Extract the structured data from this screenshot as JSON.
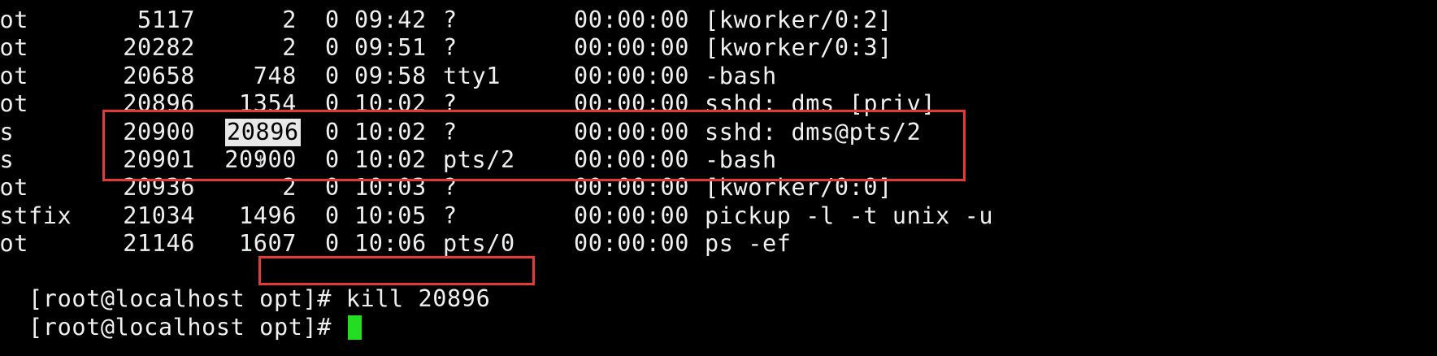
{
  "theme": {
    "background": "#000000",
    "foreground": "#f0f0f0",
    "selection_bg": "#e8e8e8",
    "cursor_color": "#22dd22",
    "annotation_color": "#e53935"
  },
  "process_rows": [
    {
      "uid": "root",
      "pid": "5117",
      "ppid": "2",
      "c": "0",
      "stime": "09:42",
      "tty": "?",
      "time": "00:00:00",
      "cmd": "[kworker/0:2]"
    },
    {
      "uid": "root",
      "pid": "20282",
      "ppid": "2",
      "c": "0",
      "stime": "09:51",
      "tty": "?",
      "time": "00:00:00",
      "cmd": "[kworker/0:3]"
    },
    {
      "uid": "root",
      "pid": "20658",
      "ppid": "748",
      "c": "0",
      "stime": "09:58",
      "tty": "tty1",
      "time": "00:00:00",
      "cmd": "-bash"
    },
    {
      "uid": "root",
      "pid": "20896",
      "ppid": "1354",
      "c": "0",
      "stime": "10:02",
      "tty": "?",
      "time": "00:00:00",
      "cmd": "sshd: dms [priv]"
    },
    {
      "uid": "dms",
      "pid": "20900",
      "ppid": "20896",
      "c": "0",
      "stime": "10:02",
      "tty": "?",
      "time": "00:00:00",
      "cmd": "sshd: dms@pts/2"
    },
    {
      "uid": "dms",
      "pid": "20901",
      "ppid": "20900",
      "c": "0",
      "stime": "10:02",
      "tty": "pts/2",
      "time": "00:00:00",
      "cmd": "-bash"
    },
    {
      "uid": "root",
      "pid": "20936",
      "ppid": "2",
      "c": "0",
      "stime": "10:03",
      "tty": "?",
      "time": "00:00:00",
      "cmd": "[kworker/0:0]"
    },
    {
      "uid": "postfix",
      "pid": "21034",
      "ppid": "1496",
      "c": "0",
      "stime": "10:05",
      "tty": "?",
      "time": "00:00:00",
      "cmd": "pickup -l -t unix -u"
    },
    {
      "uid": "root",
      "pid": "21146",
      "ppid": "1607",
      "c": "0",
      "stime": "10:06",
      "tty": "pts/0",
      "time": "00:00:00",
      "cmd": "ps -ef"
    }
  ],
  "prompt_lines": [
    {
      "prompt": "[root@localhost opt]#",
      "command": " kill 20896"
    },
    {
      "prompt": "[root@localhost opt]#",
      "command": " "
    }
  ]
}
